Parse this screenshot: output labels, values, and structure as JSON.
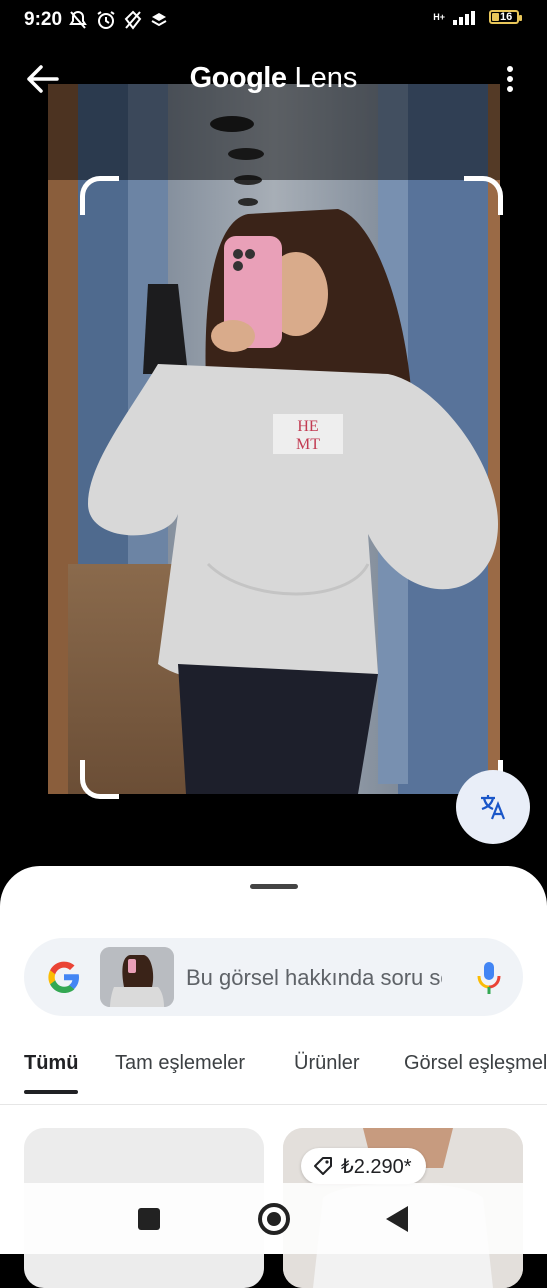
{
  "status_bar": {
    "time": "9:20",
    "network": "H+",
    "battery": "16",
    "icons": [
      "mute-bell-icon",
      "alarm-icon",
      "location-off-icon",
      "layers-icon",
      "signal-icon",
      "battery-icon"
    ]
  },
  "header": {
    "title_brand": "Google",
    "title_product": "Lens",
    "icons": [
      "back-arrow-icon",
      "more-vert-icon"
    ]
  },
  "image": {
    "print_text_line1": "HE",
    "print_text_line2": "MT"
  },
  "translate_icon": "translate-icon",
  "search": {
    "placeholder": "Bu görsel hakkında soru sorun",
    "icons": [
      "google-g-icon",
      "mic-icon"
    ]
  },
  "tabs": [
    {
      "label": "Tümü",
      "active": true
    },
    {
      "label": "Tam eşlemeler",
      "active": false
    },
    {
      "label": "Ürünler",
      "active": false
    },
    {
      "label": "Görsel eşleşmeler",
      "active": false
    }
  ],
  "results": [
    {
      "price": ""
    },
    {
      "price": "₺2.290*"
    }
  ],
  "nav": [
    "recents-square-icon",
    "home-circle-icon",
    "back-triangle-icon"
  ],
  "colors": {
    "google_blue": "#4285F4",
    "google_red": "#EA4335",
    "google_yellow": "#FBBC05",
    "google_green": "#34A853",
    "battery": "#e8c65a"
  }
}
